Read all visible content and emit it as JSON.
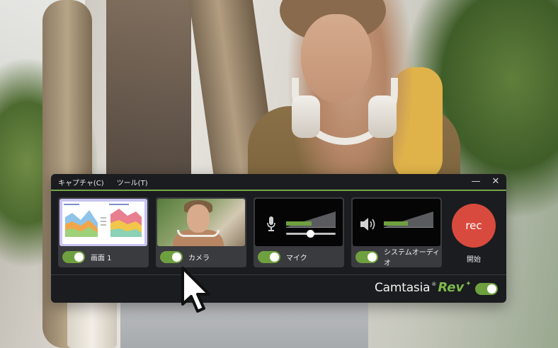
{
  "menu": {
    "capture": "キャプチャ(C)",
    "tools": "ツール(T)"
  },
  "window_controls": {
    "minimize": "—",
    "close": "✕"
  },
  "panels": [
    {
      "label": "画面 1",
      "enabled": true
    },
    {
      "label": "カメラ",
      "enabled": true
    },
    {
      "label": "マイク",
      "enabled": true
    },
    {
      "label": "システムオーディオ",
      "enabled": true
    }
  ],
  "record": {
    "button_label": "rec",
    "start_label": "開始"
  },
  "brand": {
    "name": "Camtasia",
    "mark": "®",
    "product": "Rev",
    "sparkle": "✦",
    "enabled": true
  },
  "colors": {
    "accent": "#76a648",
    "record": "#d94a3e",
    "window_bg": "#1b1c1f",
    "panel_bg": "#3a3b3f"
  },
  "icons": {
    "microphone": "microphone-icon",
    "speaker": "speaker-icon",
    "cursor": "mouse-pointer-icon"
  }
}
